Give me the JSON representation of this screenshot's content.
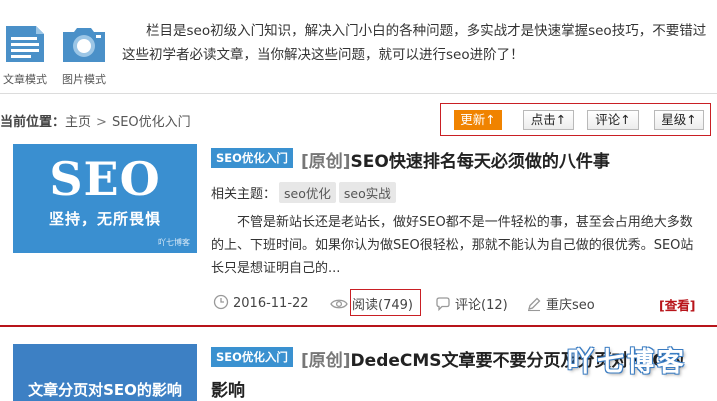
{
  "view_modes": [
    {
      "label": "文章模式",
      "icon": "document-icon"
    },
    {
      "label": "图片模式",
      "icon": "image-icon"
    }
  ],
  "intro": "栏目是seo初级入门知识，解决入门小白的各种问题，多实战才是快速掌握seo技巧，不要错过这些初学者必读文章，当你解决这些问题，就可以进行seo进阶了！",
  "breadcrumb": {
    "lead": "当前位置：",
    "home": "主页",
    "sep": ">",
    "current": "SEO优化入门"
  },
  "sort": {
    "buttons": [
      "更新↑",
      "点击↑",
      "评论↑",
      "星级↑"
    ],
    "active_index": 0,
    "active_color": "#f08300"
  },
  "articles": [
    {
      "thumb": {
        "big": "SEO",
        "sub": "坚持，无所畏惧",
        "watermark": "吖七博客",
        "color": "#3a8fd0"
      },
      "category": "SEO优化入门",
      "prefix": "[原创]",
      "title": "SEO快速排名每天必须做的八件事",
      "tags_label": "相关主题：",
      "tags": [
        "seo优化",
        "seo实战"
      ],
      "summary": "不管是新站长还是老站长，做好SEO都不是一件轻松的事，甚至会占用绝大多数的上、下班时间。如果你认为做SEO很轻松，那就不能认为自己做的很优秀。SEO站长只是想证明自己的...",
      "date": "2016-11-22",
      "reads": "阅读(749)",
      "comments": "评论(12)",
      "author": "重庆seo",
      "view": "[查看]"
    },
    {
      "thumb": {
        "sub": "文章分页对SEO的影响",
        "color": "#3d80c4"
      },
      "category": "SEO优化入门",
      "prefix": "[原创]",
      "title_line1": "DedeCMS文章要不要分页及分页对SEO的",
      "title_line2": "影响"
    }
  ],
  "brand_watermark": "吖七博客",
  "colors": {
    "accent_red": "#b8141a",
    "category_blue": "#3a91d0"
  }
}
